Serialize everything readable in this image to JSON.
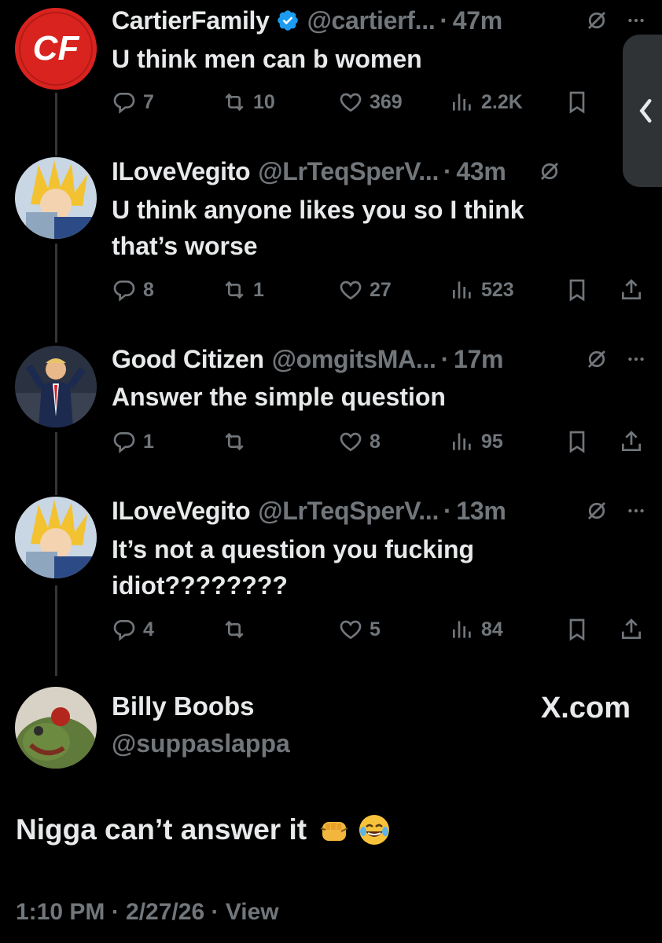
{
  "tweets": [
    {
      "name": "CartierFamily",
      "handle": "@cartierf...",
      "time": "47m",
      "text": "U think men can b women",
      "replies": "7",
      "reposts": "10",
      "likes": "369",
      "views": "2.2K"
    },
    {
      "name": "ILoveVegito",
      "handle": "@LrTeqSperV...",
      "time": "43m",
      "text": "U think anyone likes you so I think that’s worse",
      "replies": "8",
      "reposts": "1",
      "likes": "27",
      "views": "523"
    },
    {
      "name": "Good Citizen",
      "handle": "@omgitsMA...",
      "time": "17m",
      "text": "Answer the simple question",
      "replies": "1",
      "reposts": "",
      "likes": "8",
      "views": "95"
    },
    {
      "name": "ILoveVegito",
      "handle": "@LrTeqSperV...",
      "time": "13m",
      "text": "It’s not a question you fucking idiot????????",
      "replies": "4",
      "reposts": "",
      "likes": "5",
      "views": "84"
    }
  ],
  "main_post": {
    "name": "Billy Boobs",
    "handle": "@suppaslappa",
    "text": "Nigga can’t answer it",
    "meta": "1:10 PM · 2/27/26 · View",
    "watermark": "X.com"
  },
  "separator": "·",
  "logo_text": "CF",
  "icons": {
    "reply": "reply-icon",
    "repost": "repost-icon",
    "like": "like-icon",
    "views": "views-icon",
    "bookmark": "bookmark-icon",
    "share": "share-icon",
    "grok": "grok-icon",
    "more": "more-icon",
    "verified": "verified-badge-icon"
  },
  "colors": {
    "background": "#000000",
    "text": "#e7e9ea",
    "muted": "#71767b",
    "verified": "#1d9bf0",
    "line": "#333639"
  }
}
